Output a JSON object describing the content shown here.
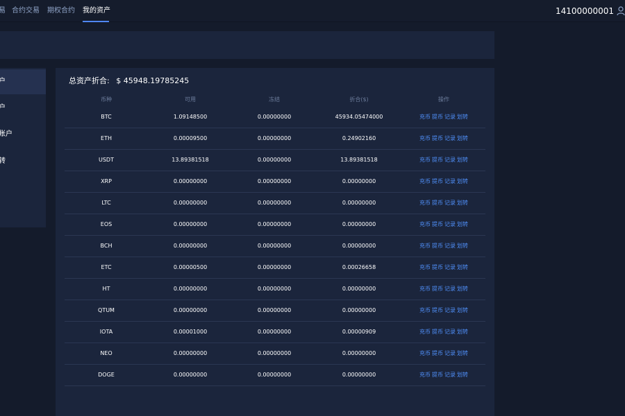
{
  "nav": {
    "items": [
      "易",
      "合约交易",
      "期权合约",
      "我的资产"
    ],
    "active": "我的资产"
  },
  "account": {
    "id": "14100000001"
  },
  "sidebar": {
    "items": [
      "户",
      "户",
      "账户",
      "转"
    ]
  },
  "assets": {
    "total_label": "总资产折合:",
    "total_value": "$ 45948.19785245",
    "headers": [
      "币种",
      "可用",
      "冻结",
      "折合($)",
      "操作"
    ],
    "ops": [
      "充币",
      "提币",
      "记录",
      "划转"
    ],
    "rows": [
      {
        "coin": "BTC",
        "available": "1.09148500",
        "frozen": "0.00000000",
        "value": "45934.05474000"
      },
      {
        "coin": "ETH",
        "available": "0.00009500",
        "frozen": "0.00000000",
        "value": "0.24902160"
      },
      {
        "coin": "USDT",
        "available": "13.89381518",
        "frozen": "0.00000000",
        "value": "13.89381518"
      },
      {
        "coin": "XRP",
        "available": "0.00000000",
        "frozen": "0.00000000",
        "value": "0.00000000"
      },
      {
        "coin": "LTC",
        "available": "0.00000000",
        "frozen": "0.00000000",
        "value": "0.00000000"
      },
      {
        "coin": "EOS",
        "available": "0.00000000",
        "frozen": "0.00000000",
        "value": "0.00000000"
      },
      {
        "coin": "BCH",
        "available": "0.00000000",
        "frozen": "0.00000000",
        "value": "0.00000000"
      },
      {
        "coin": "ETC",
        "available": "0.00000500",
        "frozen": "0.00000000",
        "value": "0.00026658"
      },
      {
        "coin": "HT",
        "available": "0.00000000",
        "frozen": "0.00000000",
        "value": "0.00000000"
      },
      {
        "coin": "QTUM",
        "available": "0.00000000",
        "frozen": "0.00000000",
        "value": "0.00000000"
      },
      {
        "coin": "IOTA",
        "available": "0.00001000",
        "frozen": "0.00000000",
        "value": "0.00000909"
      },
      {
        "coin": "NEO",
        "available": "0.00000000",
        "frozen": "0.00000000",
        "value": "0.00000000"
      },
      {
        "coin": "DOGE",
        "available": "0.00000000",
        "frozen": "0.00000000",
        "value": "0.00000000"
      }
    ]
  }
}
